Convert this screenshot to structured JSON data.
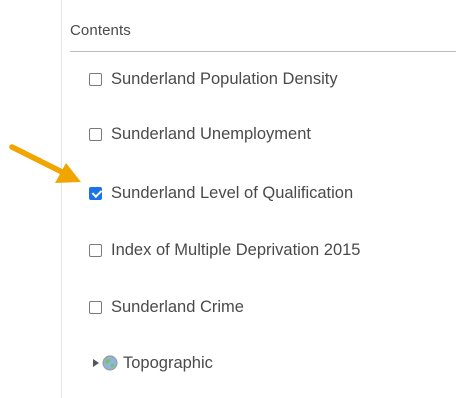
{
  "panel": {
    "title": "Contents"
  },
  "layers": [
    {
      "label": "Sunderland Population Density",
      "checked": false
    },
    {
      "label": "Sunderland Unemployment",
      "checked": false
    },
    {
      "label": "Sunderland Level of Qualification",
      "checked": true
    },
    {
      "label": "Index of Multiple Deprivation 2015",
      "checked": false
    },
    {
      "label": "Sunderland Crime",
      "checked": false
    }
  ],
  "group": {
    "label": "Topographic",
    "expanded": false,
    "icon": "globe-icon"
  },
  "annotation": {
    "icon": "pointer-arrow-icon",
    "color": "#f0a500"
  },
  "colors": {
    "checkbox_checked": "#1a73e8",
    "text": "#4a4a4a"
  }
}
